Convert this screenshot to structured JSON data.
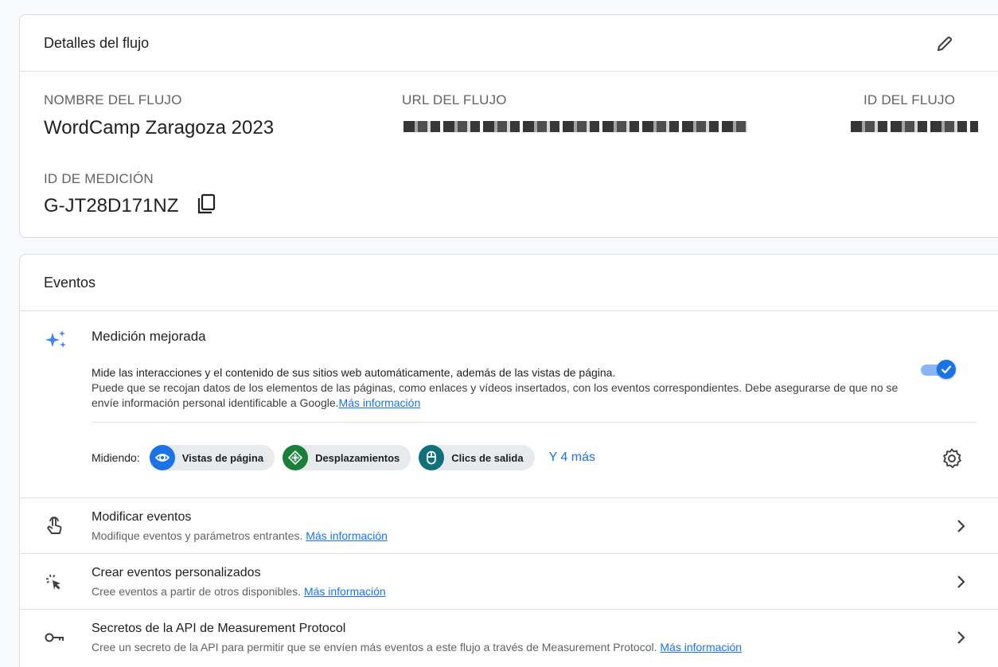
{
  "flow_details": {
    "title": "Detalles del flujo",
    "name_label": "NOMBRE DEL FLUJO",
    "name_value": "WordCamp Zaragoza 2023",
    "url_label": "URL DEL FLUJO",
    "id_label": "ID DEL FLUJO",
    "measurement_id_label": "ID DE MEDICIÓN",
    "measurement_id_value": "G-JT28D171NZ"
  },
  "events": {
    "title": "Eventos",
    "enhanced": {
      "title": "Medición mejorada",
      "desc_line1": "Mide las interacciones y el contenido de sus sitios web automáticamente, además de las vistas de página.",
      "desc_line2": "Puede que se recojan datos de los elementos de las páginas, como enlaces y vídeos insertados, con los eventos correspondientes. Debe asegurarse de que no se envíe información personal identificable a Google.",
      "more_info": "Más información",
      "toggle_on": true
    },
    "measuring": {
      "label": "Midiendo:",
      "chips": [
        {
          "label": "Vistas de página",
          "icon": "eye-icon",
          "color": "#1a73e8"
        },
        {
          "label": "Desplazamientos",
          "icon": "scroll-icon",
          "color": "#188038"
        },
        {
          "label": "Clics de salida",
          "icon": "mouse-icon",
          "color": "#12707a"
        }
      ],
      "more": "Y 4 más"
    },
    "rows": [
      {
        "title": "Modificar eventos",
        "subtitle": "Modifique eventos y parámetros entrantes.",
        "link": "Más información",
        "icon": "touch-icon"
      },
      {
        "title": "Crear eventos personalizados",
        "subtitle": "Cree eventos a partir de otros disponibles.",
        "link": "Más información",
        "icon": "click-icon"
      },
      {
        "title": "Secretos de la API de Measurement Protocol",
        "subtitle": "Cree un secreto de la API para permitir que se envíen más eventos a este flujo a través de Measurement Protocol.",
        "link": "Más información",
        "icon": "key-icon"
      }
    ]
  },
  "colors": {
    "accent": "#1a73e8",
    "border": "#dadce0",
    "text_secondary": "#5f6368"
  }
}
